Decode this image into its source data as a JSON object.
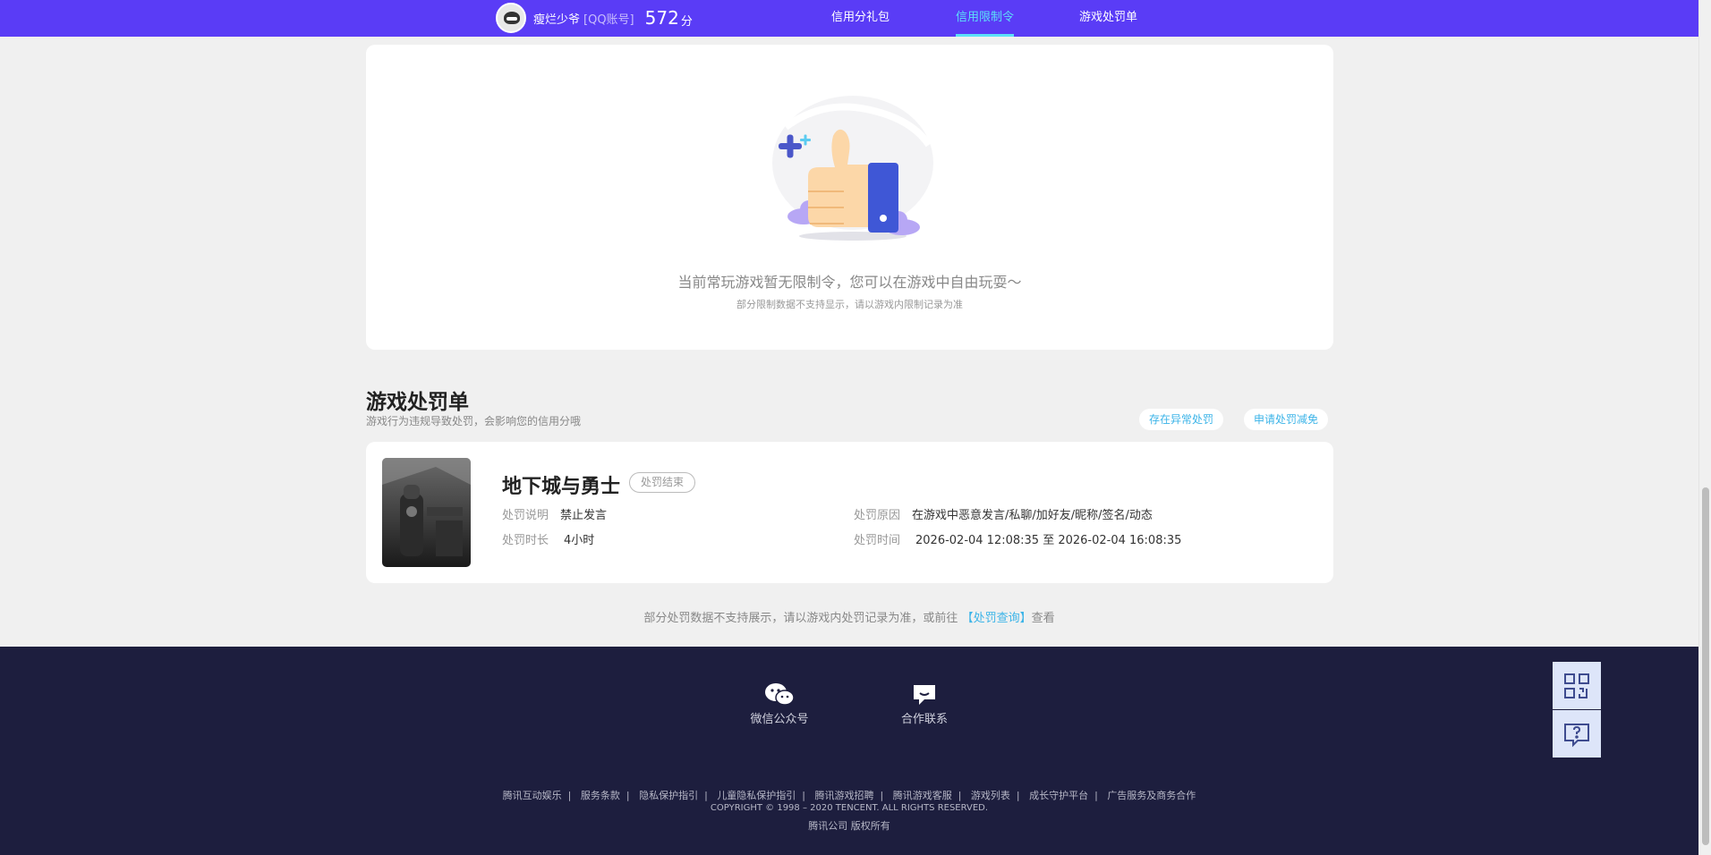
{
  "header": {
    "username": "瘦烂少爷",
    "account_type": "[QQ账号]",
    "score": "572",
    "score_unit": "分",
    "nav": [
      "信用分礼包",
      "信用限制令",
      "游戏处罚单"
    ],
    "active_nav": "信用限制令",
    "colors": {
      "bar": "#5a3cf6",
      "active": "#5ce0f8"
    }
  },
  "restriction": {
    "empty_title": "当前常玩游戏暂无限制令，您可以在游戏中自由玩耍～",
    "empty_sub": "部分限制数据不支持显示，请以游戏内限制记录为准",
    "illustration_icon": "thumbs-up-icon"
  },
  "penalty_section": {
    "title": "游戏处罚单",
    "desc": "游戏行为违规导致处罚，会影响您的信用分哦",
    "btn_abnormal": "存在异常处罚",
    "btn_reduce": "申请处罚减免",
    "item": {
      "game": "地下城与勇士",
      "status": "处罚结束",
      "desc_label": "处罚说明",
      "desc_value": "禁止发言",
      "duration_label": "处罚时长",
      "duration_value": "4小时",
      "reason_label": "处罚原因",
      "reason_value": "在游戏中恶意发言/私聊/加好友/昵称/签名/动态",
      "time_label": "处罚时间",
      "time_value": "2026-02-04 12:08:35 至 2026-02-04 16:08:35"
    },
    "note_prefix": "部分处罚数据不支持展示，请以游戏内处罚记录为准，或前往",
    "note_link": "【处罚查询】",
    "note_suffix": "查看"
  },
  "footer": {
    "wechat": "微信公众号",
    "contact": "合作联系",
    "links": [
      "腾讯互动娱乐",
      "服务条款",
      "隐私保护指引",
      "儿童隐私保护指引",
      "腾讯游戏招聘",
      "腾讯游戏客服",
      "游戏列表",
      "成长守护平台",
      "广告服务及商务合作"
    ],
    "copyright": "COPYRIGHT © 1998 – 2020 TENCENT. ALL RIGHTS RESERVED.",
    "corp": "腾讯公司 版权所有"
  },
  "float": {
    "qr_icon": "qr-code-icon",
    "help_icon": "help-chat-icon"
  }
}
